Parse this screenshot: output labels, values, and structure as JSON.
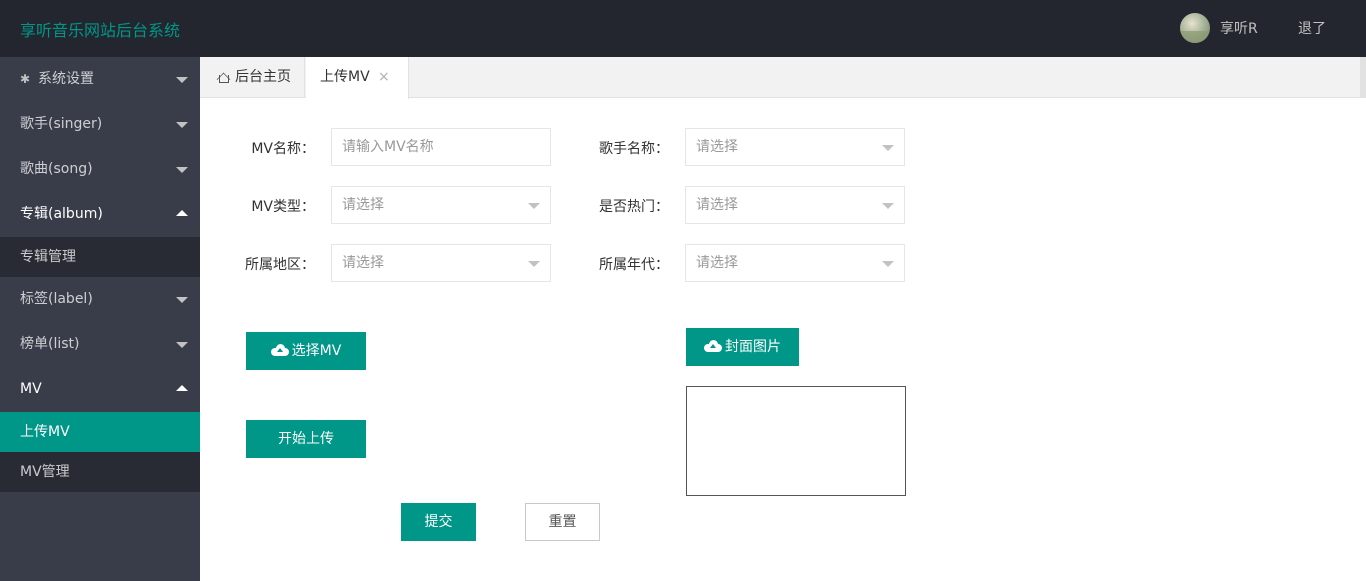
{
  "header": {
    "brand": "享听音乐网站后台系统",
    "username": "享听R",
    "logout": "退了"
  },
  "sidebar": {
    "items": [
      {
        "label": "系统设置",
        "icon": "gear-icon",
        "state": "collapsed"
      },
      {
        "label": "歌手(singer)",
        "state": "collapsed"
      },
      {
        "label": "歌曲(song)",
        "state": "collapsed"
      },
      {
        "label": "专辑(album)",
        "state": "expanded",
        "children": [
          "专辑管理"
        ]
      },
      {
        "label": "标签(label)",
        "state": "collapsed"
      },
      {
        "label": "榜单(list)",
        "state": "collapsed"
      },
      {
        "label": "MV",
        "state": "expanded",
        "children": [
          "上传MV",
          "MV管理"
        ],
        "active_child": "上传MV"
      }
    ]
  },
  "tabs": {
    "home": "后台主页",
    "current": "上传MV",
    "close_icon": "×"
  },
  "form": {
    "mv_name": {
      "label": "MV名称：",
      "placeholder": "请输入MV名称"
    },
    "singer": {
      "label": "歌手名称：",
      "value": "请选择"
    },
    "mv_type": {
      "label": "MV类型：",
      "value": "请选择"
    },
    "hot": {
      "label": "是否热门：",
      "value": "请选择"
    },
    "region": {
      "label": "所属地区：",
      "value": "请选择"
    },
    "era": {
      "label": "所属年代：",
      "value": "请选择"
    },
    "select_mv": "选择MV",
    "cover": "封面图片",
    "start_upload": "开始上传",
    "submit": "提交",
    "reset": "重置"
  },
  "colors": {
    "accent": "#009688",
    "header_bg": "#23262e",
    "sidebar_bg": "#393d49",
    "sidebar_child_bg": "#282b33"
  }
}
